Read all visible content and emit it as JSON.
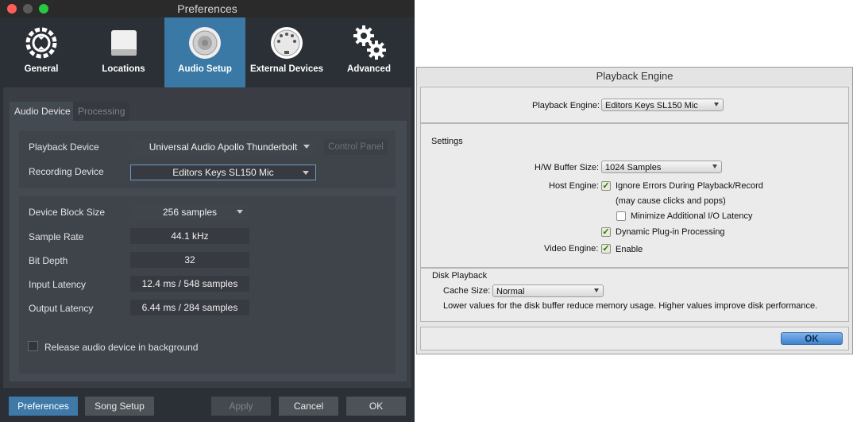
{
  "prefs": {
    "window_title": "Preferences",
    "toolbar": {
      "general": "General",
      "locations": "Locations",
      "audio_setup": "Audio Setup",
      "external_devices": "External Devices",
      "advanced": "Advanced"
    },
    "tabs": {
      "audio_device": "Audio Device",
      "processing": "Processing"
    },
    "playback_device_label": "Playback Device",
    "playback_device_value": "Universal Audio Apollo Thunderbolt",
    "control_panel": "Control Panel",
    "recording_device_label": "Recording Device",
    "recording_device_value": "Editors Keys SL150 Mic",
    "block_size_label": "Device Block Size",
    "block_size_value": "256 samples",
    "sample_rate_label": "Sample Rate",
    "sample_rate_value": "44.1 kHz",
    "bit_depth_label": "Bit Depth",
    "bit_depth_value": "32",
    "input_latency_label": "Input Latency",
    "input_latency_value": "12.4 ms / 548 samples",
    "output_latency_label": "Output Latency",
    "output_latency_value": "6.44 ms / 284 samples",
    "release_label": "Release audio device in background",
    "buttons": {
      "preferences": "Preferences",
      "song_setup": "Song Setup",
      "apply": "Apply",
      "cancel": "Cancel",
      "ok": "OK"
    },
    "colors": {
      "accent": "#3a78a6",
      "background": "#2b3036"
    }
  },
  "playback_engine": {
    "title": "Playback Engine",
    "engine_label": "Playback Engine:",
    "engine_value": "Editors Keys SL150 Mic",
    "settings_heading": "Settings",
    "hw_buffer_label": "H/W Buffer Size:",
    "hw_buffer_value": "1024 Samples",
    "host_engine_label": "Host Engine:",
    "ignore_errors": "Ignore Errors During Playback/Record",
    "ignore_errors_note": "(may cause clicks and pops)",
    "minimize_latency": "Minimize Additional I/O Latency",
    "dynamic_plugin": "Dynamic Plug-in Processing",
    "video_engine_label": "Video Engine:",
    "video_enable": "Enable",
    "disk_heading": "Disk Playback",
    "cache_size_label": "Cache Size:",
    "cache_size_value": "Normal",
    "disk_note": "Lower values for the disk buffer reduce memory usage.  Higher values improve disk performance.",
    "ok": "OK",
    "checkmark": "✓"
  }
}
